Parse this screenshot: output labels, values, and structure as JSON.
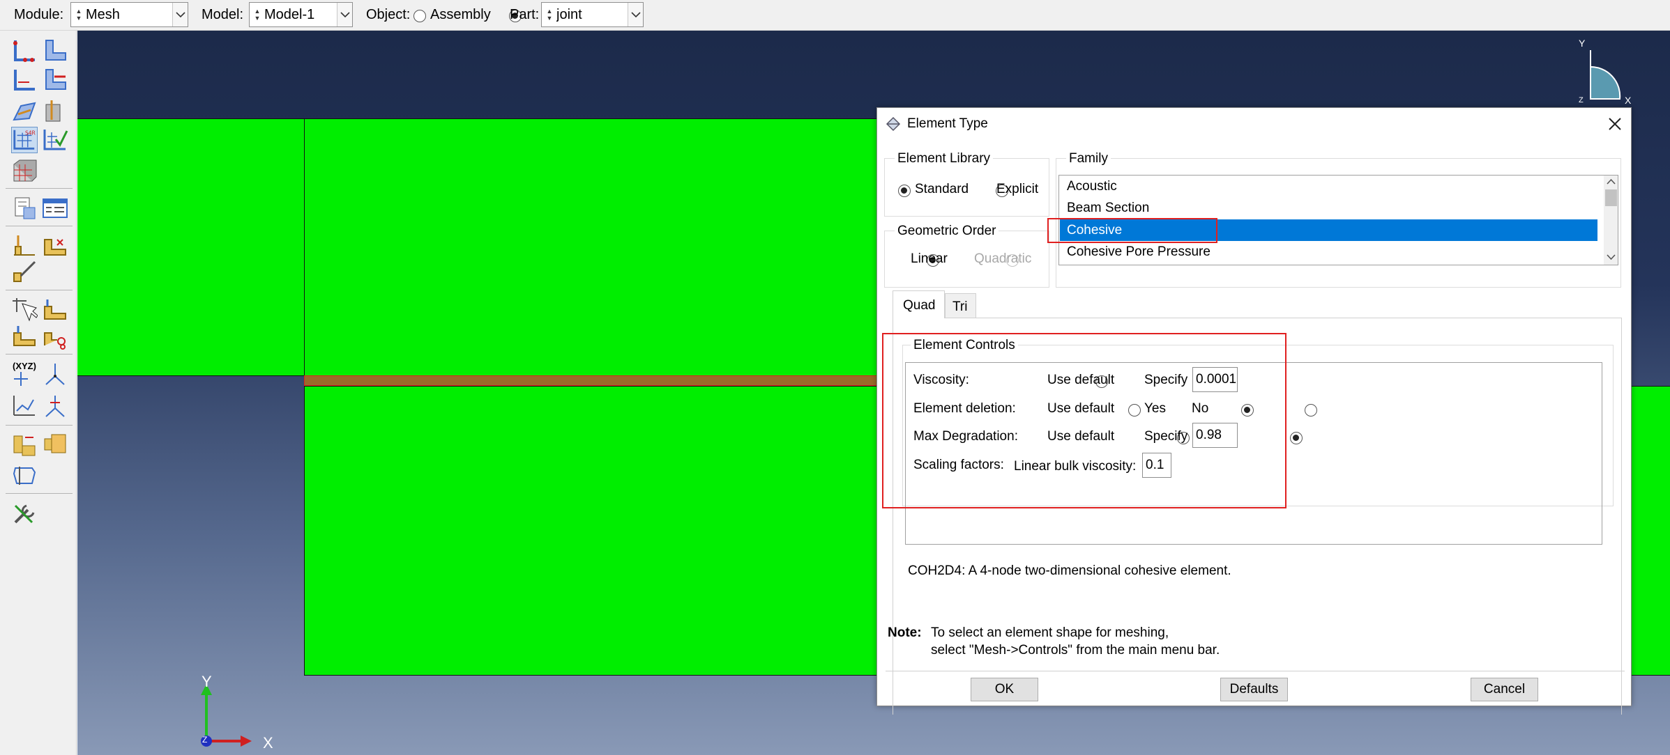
{
  "context_bar": {
    "module_label": "Module:",
    "module_value": "Mesh",
    "model_label": "Model:",
    "model_value": "Model-1",
    "object_label": "Object:",
    "assembly_label": "Assembly",
    "part_label": "Part:",
    "part_value": "joint",
    "object_selected": "Part"
  },
  "toolbox": {
    "tools": [
      "seed-part-icon",
      "seed-edge-icon",
      "seed-by-number-icon",
      "delete-seeds-icon",
      "assign-mesh-controls-icon",
      "assign-stack-direction-icon",
      "element-type-icon",
      "verify-mesh-icon",
      "mesh-part-icon",
      "virtual-topology-icon",
      "mesh-region-icon",
      "query-icon",
      "partition-edge-icon",
      "partition-face-icon",
      "edit-mesh-icon",
      "select-node-icon",
      "adaptivity-icon",
      "remesh-icon",
      "create-datum-point-icon",
      "create-datum-axis-icon",
      "datum-plane-icon",
      "datum-csys-icon",
      "merge-parts-icon",
      "instance-parts-icon",
      "repair-geometry-icon",
      "tools-icon"
    ],
    "xyz_label": "(XYZ)"
  },
  "viewport": {
    "triad_y": "Y",
    "triad_x": "X",
    "triad_z": "Z",
    "mini_triad_y": "Y",
    "mini_triad_x": "X",
    "mini_triad_z": "Z",
    "part_color": "#00ee00",
    "cohesive_layer_color": "#9a6a2a"
  },
  "dialog": {
    "title": "Element Type",
    "element_library": {
      "legend": "Element Library",
      "options": [
        "Standard",
        "Explicit"
      ],
      "selected": "Standard"
    },
    "family": {
      "legend": "Family",
      "items": [
        "Acoustic",
        "Beam Section",
        "Cohesive",
        "Cohesive Pore Pressure"
      ],
      "selected": "Cohesive"
    },
    "geometric_order": {
      "legend": "Geometric Order",
      "options": [
        "Linear",
        "Quadratic"
      ],
      "selected": "Linear"
    },
    "tabs": [
      "Quad",
      "Tri"
    ],
    "active_tab": "Quad",
    "element_controls": {
      "legend": "Element Controls",
      "viscosity_label": "Viscosity:",
      "viscosity_options": [
        "Use default",
        "Specify"
      ],
      "viscosity_selected": "Specify",
      "viscosity_value": "0.0001",
      "deletion_label": "Element deletion:",
      "deletion_options": [
        "Use default",
        "Yes",
        "No"
      ],
      "deletion_selected": "Yes",
      "degradation_label": "Max Degradation:",
      "degradation_options": [
        "Use default",
        "Specify"
      ],
      "degradation_selected": "Specify",
      "degradation_value": "0.98",
      "scaling_label": "Scaling factors:",
      "bulk_viscosity_label": "Linear bulk viscosity:",
      "bulk_viscosity_value": "0.1"
    },
    "element_description": "COH2D4: A 4-node two-dimensional cohesive element.",
    "note_label": "Note:",
    "note_line1": "To select an element shape for meshing,",
    "note_line2": "select \"Mesh->Controls\" from the main menu bar.",
    "buttons": {
      "ok": "OK",
      "defaults": "Defaults",
      "cancel": "Cancel"
    },
    "highlight_color": "#0078d7",
    "annotation_color": "#e02020"
  }
}
